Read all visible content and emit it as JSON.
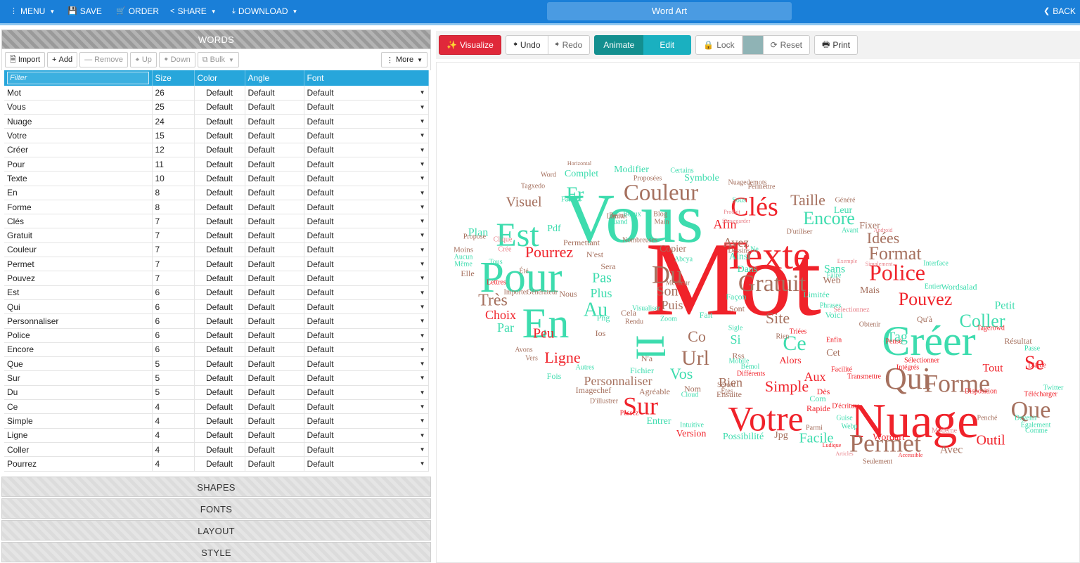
{
  "topbar": {
    "menu": "MENU",
    "save": "SAVE",
    "order": "ORDER",
    "share": "SHARE",
    "download": "DOWNLOAD",
    "title": "Word Art",
    "back": "BACK"
  },
  "words_panel": {
    "header": "WORDS",
    "toolbar": {
      "import": "Import",
      "add": "Add",
      "remove": "Remove",
      "up": "Up",
      "down": "Down",
      "bulk": "Bulk",
      "more": "More"
    },
    "columns": [
      "Size",
      "Color",
      "Angle",
      "Font"
    ],
    "filter_placeholder": "Filter",
    "rows": [
      {
        "word": "Mot",
        "size": "26",
        "color": "Default",
        "angle": "Default",
        "font": "Default"
      },
      {
        "word": "Vous",
        "size": "25",
        "color": "Default",
        "angle": "Default",
        "font": "Default"
      },
      {
        "word": "Nuage",
        "size": "24",
        "color": "Default",
        "angle": "Default",
        "font": "Default"
      },
      {
        "word": "Votre",
        "size": "15",
        "color": "Default",
        "angle": "Default",
        "font": "Default"
      },
      {
        "word": "Créer",
        "size": "12",
        "color": "Default",
        "angle": "Default",
        "font": "Default"
      },
      {
        "word": "Pour",
        "size": "11",
        "color": "Default",
        "angle": "Default",
        "font": "Default"
      },
      {
        "word": "Texte",
        "size": "10",
        "color": "Default",
        "angle": "Default",
        "font": "Default"
      },
      {
        "word": "En",
        "size": "8",
        "color": "Default",
        "angle": "Default",
        "font": "Default"
      },
      {
        "word": "Forme",
        "size": "8",
        "color": "Default",
        "angle": "Default",
        "font": "Default"
      },
      {
        "word": "Clés",
        "size": "7",
        "color": "Default",
        "angle": "Default",
        "font": "Default"
      },
      {
        "word": "Gratuit",
        "size": "7",
        "color": "Default",
        "angle": "Default",
        "font": "Default"
      },
      {
        "word": "Couleur",
        "size": "7",
        "color": "Default",
        "angle": "Default",
        "font": "Default"
      },
      {
        "word": "Permet",
        "size": "7",
        "color": "Default",
        "angle": "Default",
        "font": "Default"
      },
      {
        "word": "Pouvez",
        "size": "7",
        "color": "Default",
        "angle": "Default",
        "font": "Default"
      },
      {
        "word": "Est",
        "size": "6",
        "color": "Default",
        "angle": "Default",
        "font": "Default"
      },
      {
        "word": "Qui",
        "size": "6",
        "color": "Default",
        "angle": "Default",
        "font": "Default"
      },
      {
        "word": "Personnaliser",
        "size": "6",
        "color": "Default",
        "angle": "Default",
        "font": "Default"
      },
      {
        "word": "Police",
        "size": "6",
        "color": "Default",
        "angle": "Default",
        "font": "Default"
      },
      {
        "word": "Encore",
        "size": "6",
        "color": "Default",
        "angle": "Default",
        "font": "Default"
      },
      {
        "word": "Que",
        "size": "5",
        "color": "Default",
        "angle": "Default",
        "font": "Default"
      },
      {
        "word": "Sur",
        "size": "5",
        "color": "Default",
        "angle": "Default",
        "font": "Default"
      },
      {
        "word": "Du",
        "size": "5",
        "color": "Default",
        "angle": "Default",
        "font": "Default"
      },
      {
        "word": "Ce",
        "size": "4",
        "color": "Default",
        "angle": "Default",
        "font": "Default"
      },
      {
        "word": "Simple",
        "size": "4",
        "color": "Default",
        "angle": "Default",
        "font": "Default"
      },
      {
        "word": "Ligne",
        "size": "4",
        "color": "Default",
        "angle": "Default",
        "font": "Default"
      },
      {
        "word": "Coller",
        "size": "4",
        "color": "Default",
        "angle": "Default",
        "font": "Default"
      },
      {
        "word": "Pourrez",
        "size": "4",
        "color": "Default",
        "angle": "Default",
        "font": "Default"
      }
    ]
  },
  "accordion": [
    "SHAPES",
    "FONTS",
    "LAYOUT",
    "STYLE"
  ],
  "viz_toolbar": {
    "visualize": "Visualize",
    "undo": "Undo",
    "redo": "Redo",
    "animate": "Animate",
    "edit": "Edit",
    "lock": "Lock",
    "reset": "Reset",
    "print": "Print",
    "swatch_color": "#8fb3b5"
  },
  "colors": {
    "red": "#f0222a",
    "teal": "#3ddcae",
    "brown": "#a5705e",
    "pink": "#e8838b",
    "topbar": "#1a7fd8"
  },
  "cloud": [
    {
      "t": "Mot",
      "c": "red"
    },
    {
      "t": "Vous",
      "c": "teal"
    },
    {
      "t": "Nuage",
      "c": "red"
    },
    {
      "t": "Votre",
      "c": "red"
    },
    {
      "t": "Créer",
      "c": "teal"
    },
    {
      "t": "Pour",
      "c": "teal"
    },
    {
      "t": "Texte",
      "c": "red"
    },
    {
      "t": "En",
      "c": "teal"
    },
    {
      "t": "Il",
      "c": "teal"
    },
    {
      "t": "Forme",
      "c": "brown"
    },
    {
      "t": "Gratuit",
      "c": "brown"
    },
    {
      "t": "Est",
      "c": "teal"
    },
    {
      "t": "Couleur",
      "c": "brown"
    },
    {
      "t": "Clés",
      "c": "red"
    },
    {
      "t": "Qui",
      "c": "brown"
    },
    {
      "t": "Que",
      "c": "brown"
    },
    {
      "t": "Permet",
      "c": "brown"
    },
    {
      "t": "Police",
      "c": "red"
    },
    {
      "t": "Pouvez",
      "c": "red"
    },
    {
      "t": "Du",
      "c": "brown"
    },
    {
      "t": "Sur",
      "c": "red"
    },
    {
      "t": "Ce",
      "c": "teal"
    },
    {
      "t": "Au",
      "c": "teal"
    },
    {
      "t": "Url",
      "c": "brown"
    },
    {
      "t": "Fr",
      "c": "teal"
    },
    {
      "t": "Se",
      "c": "red"
    },
    {
      "t": "Tag",
      "c": "teal"
    },
    {
      "t": "Coller",
      "c": "teal"
    },
    {
      "t": "Encore",
      "c": "teal"
    },
    {
      "t": "Taille",
      "c": "brown"
    },
    {
      "t": "Format",
      "c": "brown"
    },
    {
      "t": "Idées",
      "c": "brown"
    },
    {
      "t": "Pourrez",
      "c": "red"
    },
    {
      "t": "Personnaliser",
      "c": "brown"
    },
    {
      "t": "Ligne",
      "c": "red"
    },
    {
      "t": "Simple",
      "c": "red"
    },
    {
      "t": "Site",
      "c": "brown"
    },
    {
      "t": "Son",
      "c": "brown"
    },
    {
      "t": "Très",
      "c": "brown"
    },
    {
      "t": "Pas",
      "c": "teal"
    },
    {
      "t": "Plus",
      "c": "teal"
    },
    {
      "t": "Visuel",
      "c": "brown"
    },
    {
      "t": "Choix",
      "c": "red"
    },
    {
      "t": "Outil",
      "c": "red"
    },
    {
      "t": "Facile",
      "c": "teal"
    },
    {
      "t": "Bien",
      "c": "brown"
    },
    {
      "t": "Avez",
      "c": "brown"
    },
    {
      "t": "Puis",
      "c": "brown"
    },
    {
      "t": "Tout",
      "c": "red"
    },
    {
      "t": "Peu",
      "c": "red"
    },
    {
      "t": "Par",
      "c": "teal"
    },
    {
      "t": "Aux",
      "c": "red"
    },
    {
      "t": "Co",
      "c": "brown"
    },
    {
      "t": "Si",
      "c": "teal"
    },
    {
      "t": "Vos",
      "c": "teal"
    },
    {
      "t": "Sans",
      "c": "teal"
    },
    {
      "t": "Mais",
      "c": "brown"
    },
    {
      "t": "Web",
      "c": "brown"
    },
    {
      "t": "Dans",
      "c": "teal"
    },
    {
      "t": "Ainsi",
      "c": "teal"
    },
    {
      "t": "Copier",
      "c": "brown"
    },
    {
      "t": "Alors",
      "c": "red"
    },
    {
      "t": "Plan",
      "c": "teal"
    },
    {
      "t": "Complet",
      "c": "teal"
    },
    {
      "t": "Symbole",
      "c": "teal"
    },
    {
      "t": "Modifier",
      "c": "teal"
    },
    {
      "t": "Afin",
      "c": "red"
    },
    {
      "t": "Leur",
      "c": "teal"
    },
    {
      "t": "Fixer",
      "c": "brown"
    },
    {
      "t": "Petit",
      "c": "teal"
    },
    {
      "t": "Avec",
      "c": "brown"
    },
    {
      "t": "Version",
      "c": "red"
    },
    {
      "t": "Possibilité",
      "c": "teal"
    },
    {
      "t": "Jpg",
      "c": "brown"
    },
    {
      "t": "Wordart",
      "c": "red"
    },
    {
      "t": "Entrer",
      "c": "teal"
    },
    {
      "t": "Ensuite",
      "c": "brown"
    },
    {
      "t": "Fichier",
      "c": "teal"
    },
    {
      "t": "Sont",
      "c": "brown"
    },
    {
      "t": "Façon",
      "c": "teal"
    },
    {
      "t": "Fois",
      "c": "teal"
    },
    {
      "t": "Moins",
      "c": "brown"
    },
    {
      "t": "Elle",
      "c": "brown"
    },
    {
      "t": "Propose",
      "c": "brown"
    },
    {
      "t": "Pdf",
      "c": "teal"
    },
    {
      "t": "Word",
      "c": "brown"
    },
    {
      "t": "Permettant",
      "c": "brown"
    },
    {
      "t": "N'est",
      "c": "brown"
    },
    {
      "t": "Sera",
      "c": "brown"
    },
    {
      "t": "Qu'à",
      "c": "brown"
    },
    {
      "t": "Voici",
      "c": "teal"
    },
    {
      "t": "Nous",
      "c": "brown"
    },
    {
      "t": "Cela",
      "c": "brown"
    },
    {
      "t": "Seulement",
      "c": "brown"
    },
    {
      "t": "Résultat",
      "c": "brown"
    },
    {
      "t": "Rss",
      "c": "brown"
    },
    {
      "t": "Agréable",
      "c": "brown"
    },
    {
      "t": "Imagechef",
      "c": "brown"
    },
    {
      "t": "Nom",
      "c": "brown"
    },
    {
      "t": "Fait",
      "c": "teal"
    },
    {
      "t": "Lettres",
      "c": "red"
    },
    {
      "t": "Rapide",
      "c": "red"
    },
    {
      "t": "Été",
      "c": "brown"
    },
    {
      "t": "Phrases",
      "c": "teal"
    },
    {
      "t": "Parmi",
      "c": "brown"
    },
    {
      "t": "Guise",
      "c": "teal"
    },
    {
      "t": "Webp",
      "c": "teal"
    },
    {
      "t": "Cet",
      "c": "brown"
    },
    {
      "t": "Dès",
      "c": "red"
    },
    {
      "t": "Com",
      "c": "teal"
    },
    {
      "t": "Enfin",
      "c": "red"
    },
    {
      "t": "Png",
      "c": "teal"
    },
    {
      "t": "Ios",
      "c": "brown"
    },
    {
      "t": "N'a",
      "c": "brown"
    },
    {
      "t": "Zoom",
      "c": "teal"
    },
    {
      "t": "Limitée",
      "c": "teal"
    },
    {
      "t": "Meilleur",
      "c": "brown"
    },
    {
      "t": "Tous",
      "c": "teal"
    },
    {
      "t": "Nuagedemots",
      "c": "brown"
    },
    {
      "t": "Blog",
      "c": "brown"
    },
    {
      "t": "Limite",
      "c": "brown"
    },
    {
      "t": "Quand",
      "c": "teal"
    },
    {
      "t": "Abcya",
      "c": "teal"
    },
    {
      "t": "Dessins",
      "c": "brown"
    },
    {
      "t": "Faire",
      "c": "teal"
    },
    {
      "t": "Avons",
      "c": "brown"
    },
    {
      "t": "Vers",
      "c": "brown"
    },
    {
      "t": "Triées",
      "c": "red"
    },
    {
      "t": "Rien",
      "c": "brown"
    },
    {
      "t": "Sigle",
      "c": "teal"
    },
    {
      "t": "Mobile",
      "c": "teal"
    },
    {
      "t": "Ne",
      "c": "teal"
    },
    {
      "t": "D'utiliser",
      "c": "brown"
    },
    {
      "t": "Avant",
      "c": "teal"
    },
    {
      "t": "Tagxedo",
      "c": "brown"
    },
    {
      "t": "Proposées",
      "c": "brown"
    },
    {
      "t": "Certains",
      "c": "teal"
    },
    {
      "t": "Générateur",
      "c": "brown"
    },
    {
      "t": "Importer",
      "c": "brown"
    },
    {
      "t": "Interface",
      "c": "teal"
    },
    {
      "t": "Également",
      "c": "teal"
    },
    {
      "t": "Télécharger",
      "c": "red"
    },
    {
      "t": "Disposition",
      "c": "red"
    },
    {
      "t": "Sélectionner",
      "c": "red"
    },
    {
      "t": "Intégrés",
      "c": "red"
    },
    {
      "t": "Transmettre",
      "c": "red"
    },
    {
      "t": "Facilité",
      "c": "red"
    },
    {
      "t": "D'écriture",
      "c": "red"
    },
    {
      "t": "Différents",
      "c": "red"
    },
    {
      "t": "Seront",
      "c": "brown"
    },
    {
      "t": "Êtes",
      "c": "brown"
    },
    {
      "t": "Sélectionnez",
      "c": "pink"
    },
    {
      "t": "Obtenir",
      "c": "brown"
    },
    {
      "t": "Pensé",
      "c": "red"
    },
    {
      "t": "Passe",
      "c": "teal"
    },
    {
      "t": "Moderne",
      "c": "pink"
    },
    {
      "t": "Beaux",
      "c": "brown"
    },
    {
      "t": "Main",
      "c": "brown"
    },
    {
      "t": "Faudra",
      "c": "teal"
    },
    {
      "t": "Aucun",
      "c": "teal"
    },
    {
      "t": "Même",
      "c": "teal"
    },
    {
      "t": "Sous",
      "c": "teal"
    },
    {
      "t": "Clique",
      "c": "pink"
    },
    {
      "t": "Crée",
      "c": "pink"
    },
    {
      "t": "Nombreuses",
      "c": "brown"
    },
    {
      "t": "Entier",
      "c": "teal"
    },
    {
      "t": "Wordsalad",
      "c": "teal"
    },
    {
      "t": "Tagerowd",
      "c": "red"
    },
    {
      "t": "Autres",
      "c": "teal"
    },
    {
      "t": "Rendu",
      "c": "brown"
    },
    {
      "t": "Visualiser",
      "c": "teal"
    },
    {
      "t": "Intuitive",
      "c": "teal"
    },
    {
      "t": "Bémol",
      "c": "teal"
    },
    {
      "t": "Passez",
      "c": "red"
    },
    {
      "t": "D'illustrer",
      "c": "brown"
    },
    {
      "t": "Cloud",
      "c": "teal"
    },
    {
      "t": "Accessible",
      "c": "red"
    },
    {
      "t": "Beaux",
      "c": "teal"
    },
    {
      "t": "Horizontal",
      "c": "brown"
    },
    {
      "t": "Permettre",
      "c": "brown"
    },
    {
      "t": "Produit",
      "c": "pink"
    },
    {
      "t": "Sauvegarder",
      "c": "pink"
    },
    {
      "t": "Généré",
      "c": "brown"
    },
    {
      "t": "Android",
      "c": "pink"
    },
    {
      "t": "Simplement",
      "c": "pink"
    },
    {
      "t": "Exemple",
      "c": "pink"
    },
    {
      "t": "D'aide",
      "c": "red"
    },
    {
      "t": "Twitter",
      "c": "teal"
    },
    {
      "t": "Comme",
      "c": "teal"
    },
    {
      "t": "Ludique",
      "c": "red"
    },
    {
      "t": "Articles",
      "c": "pink"
    },
    {
      "t": "Penché",
      "c": "brown"
    },
    {
      "t": "Devenir",
      "c": "teal"
    }
  ]
}
